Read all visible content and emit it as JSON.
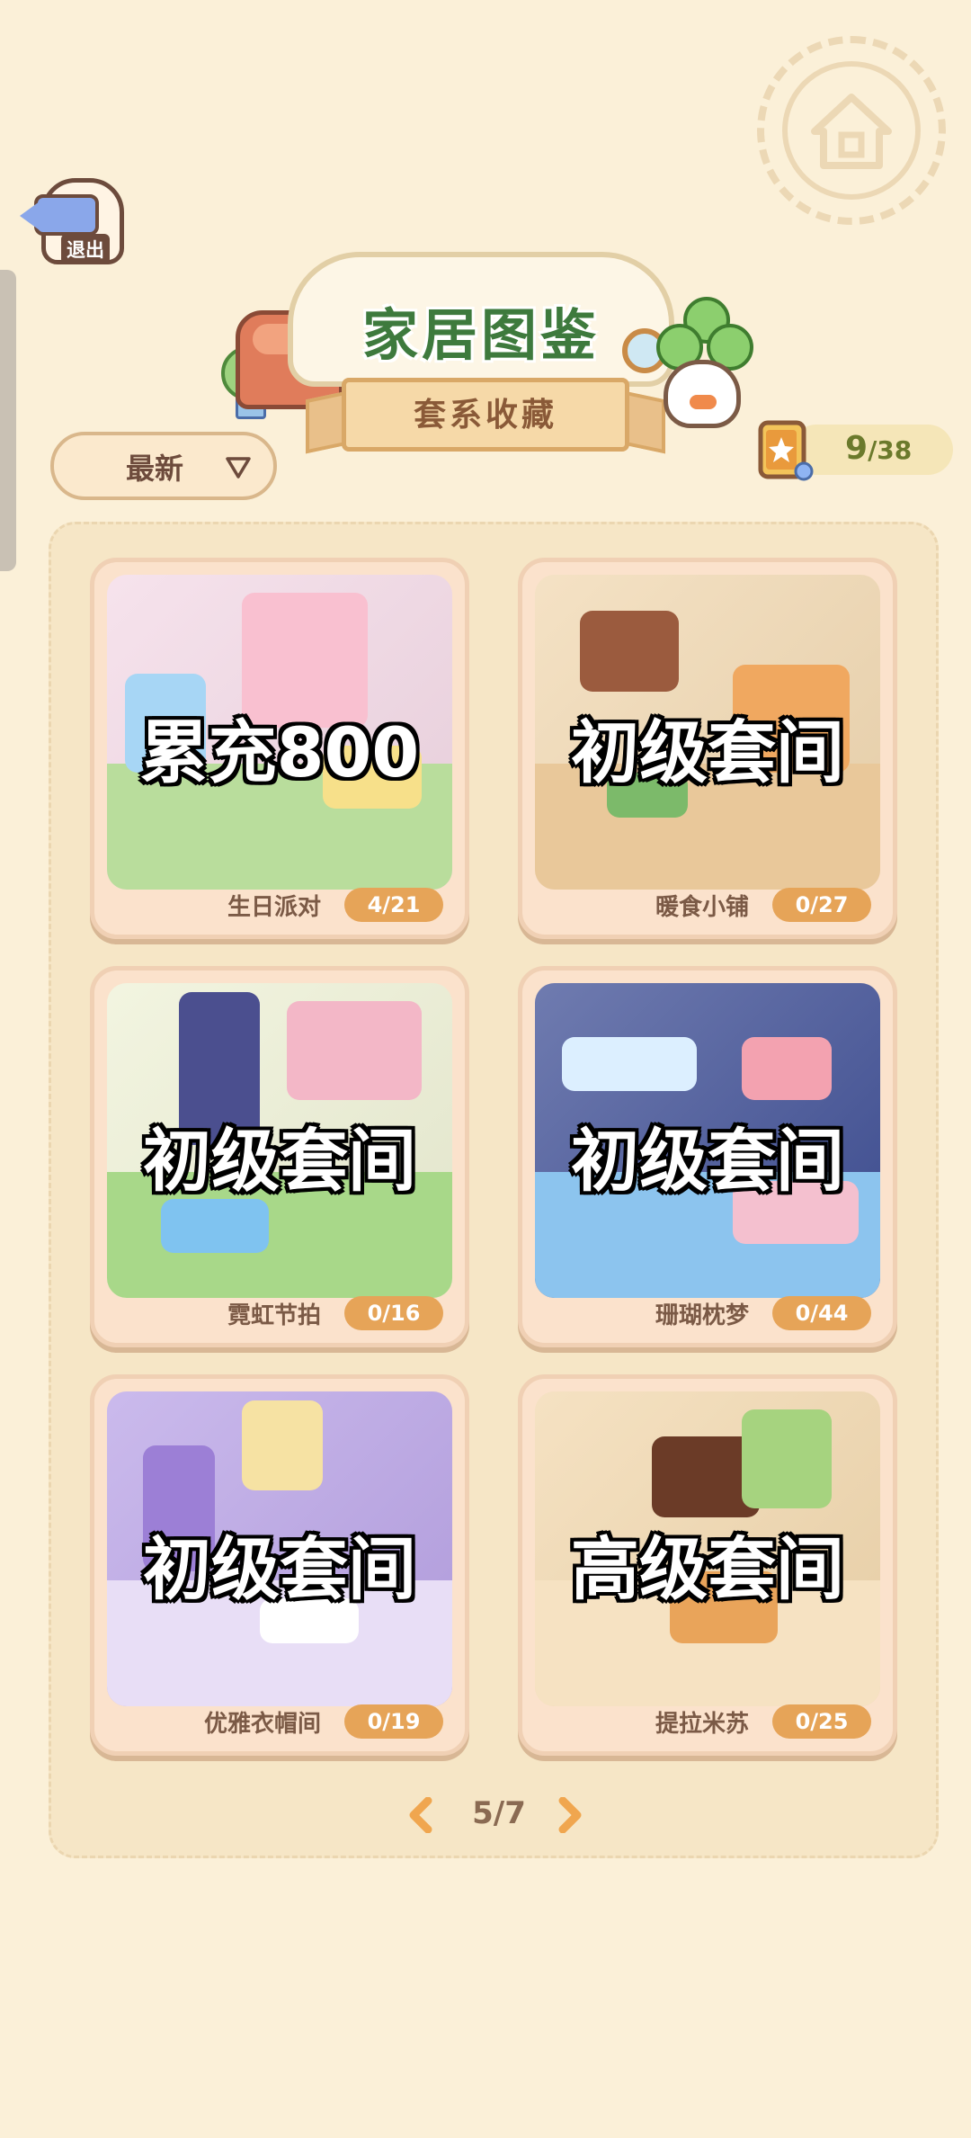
{
  "header": {
    "exit_label": "退出",
    "title": "家居图鉴",
    "subtitle": "套系收藏"
  },
  "sort": {
    "selected": "最新"
  },
  "counter": {
    "collected": "9",
    "total": "/38"
  },
  "cards": [
    {
      "tag": "累充800",
      "name": "生日派对",
      "progress": "4/21",
      "colors": {
        "bg": "#f3d9e6",
        "floor": "#b9dd9c",
        "a": "#f9c0d0",
        "b": "#a7d6f5",
        "c": "#f7e08a"
      }
    },
    {
      "tag": "初级套间",
      "name": "暖食小铺",
      "progress": "0/27",
      "colors": {
        "bg": "#f1d8b1",
        "floor": "#e9c89a",
        "a": "#9b5b3e",
        "b": "#f0a860",
        "c": "#7cba6a"
      }
    },
    {
      "tag": "初级套间",
      "name": "霓虹节拍",
      "progress": "0/16",
      "colors": {
        "bg": "#eef1d6",
        "floor": "#a8d889",
        "a": "#4b4f8f",
        "b": "#f3b7c7",
        "c": "#7fc3f0"
      }
    },
    {
      "tag": "初级套间",
      "name": "珊瑚枕梦",
      "progress": "0/44",
      "colors": {
        "bg": "#3f4f95",
        "floor": "#8cc4ee",
        "a": "#f4c0cf",
        "b": "#dcefff",
        "c": "#f3a2b0"
      }
    },
    {
      "tag": "初级套间",
      "name": "优雅衣帽间",
      "progress": "0/19",
      "colors": {
        "bg": "#b9a3e6",
        "floor": "#e8def6",
        "a": "#f6e2a3",
        "b": "#9c7fd6",
        "c": "#ffffff"
      }
    },
    {
      "tag": "高级套间",
      "name": "提拉米苏",
      "progress": "0/25",
      "colors": {
        "bg": "#f2d8ae",
        "floor": "#f6e2c2",
        "a": "#6b3b27",
        "b": "#e9a45a",
        "c": "#a6d37f"
      }
    }
  ],
  "pagination": {
    "current": "5/7"
  }
}
